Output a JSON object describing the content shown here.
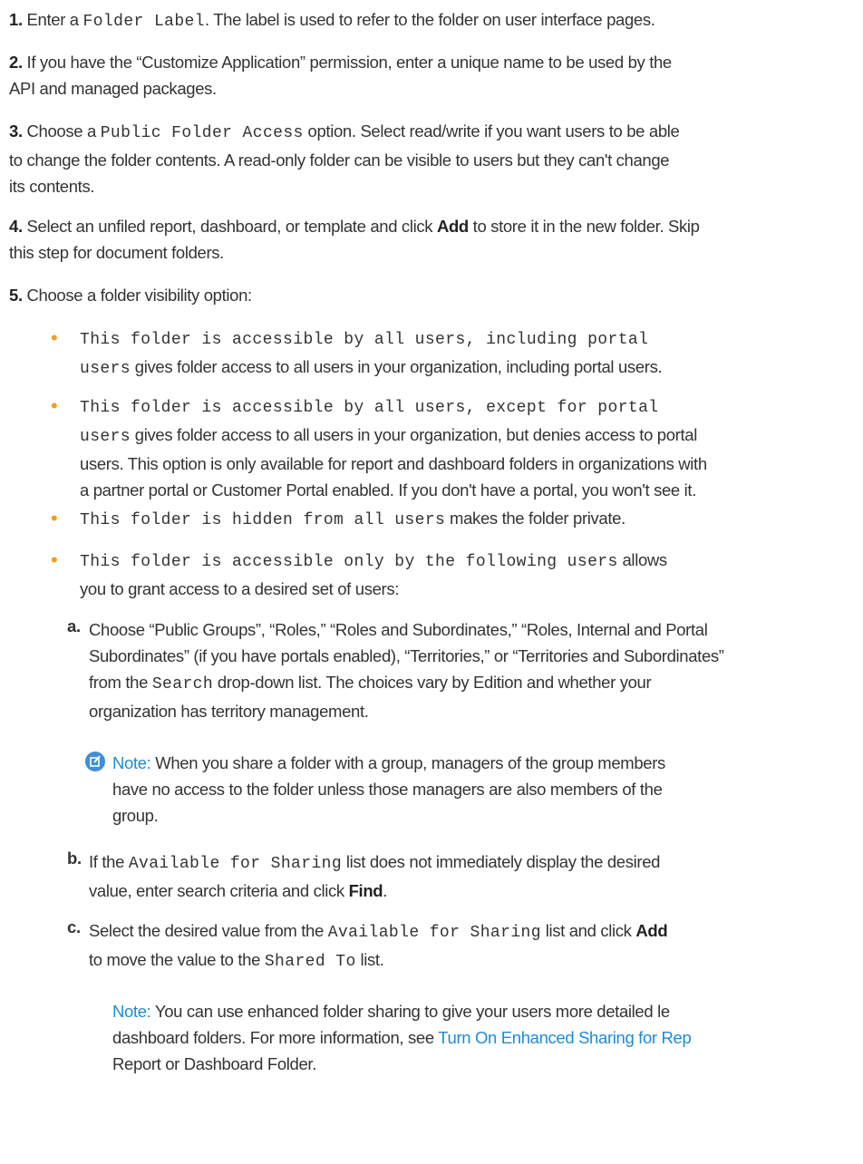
{
  "steps": [
    {
      "num": "1.",
      "a": "Enter a ",
      "code": "Folder Label",
      "b": ". The label is used to refer to the folder on user interface pages."
    },
    {
      "num": "2.",
      "l1": "If you have the “Customize Application” permission, enter a unique name to be used by the",
      "l2": "API and managed packages."
    },
    {
      "num": "3.",
      "a": "Choose a ",
      "code": "Public Folder Access",
      "b": " option. Select read/write if you want users to be able",
      "l2": "to change the folder contents. A read-only folder can be visible to users but they can't change",
      "l3": "its contents."
    },
    {
      "num": "4.",
      "a": "Select an unfiled report, dashboard, or template and click ",
      "bold": "Add",
      "b": " to store it in the new folder. Skip",
      "l2": "this step for document folders."
    },
    {
      "num": "5.",
      "a": "Choose a folder visibility option:"
    }
  ],
  "bullets": [
    {
      "code1": "This folder is accessible by all users, including portal",
      "code2": "users",
      "rest": " gives folder access to all users in your organization, including portal users."
    },
    {
      "code1": "This folder is accessible by all users, except for portal",
      "code2": "users",
      "rest": " gives folder access to all users in your organization, but denies access to portal",
      "l3": "users. This option is only available for report and dashboard folders in organizations with",
      "l4": "a partner portal or Customer Portal enabled. If you don't have a portal, you won't see it."
    },
    {
      "code1": "This folder is hidden from all users",
      "rest": " makes the folder private."
    },
    {
      "code1": "This folder is accessible only by the following users",
      "rest": " allows",
      "l2": "you to grant access to a desired set of users:"
    }
  ],
  "substeps": [
    {
      "lt": "a.",
      "l1": "Choose “Public Groups”, “Roles,” “Roles and Subordinates,” “Roles, Internal and Portal",
      "l2": "Subordinates” (if you have portals enabled), “Territories,” or “Territories and Subordinates”",
      "l3a": "from the ",
      "l3code": "Search",
      "l3b": " drop-down list. The choices vary by Edition and whether your",
      "l4": "organization has territory management."
    },
    {
      "lt": "b.",
      "a": "If the ",
      "code": "Available for Sharing",
      "b": " list does not immediately display the desired",
      "l2a": "value, enter search criteria and click ",
      "l2bold": "Find",
      "l2b": "."
    },
    {
      "lt": "c.",
      "a": "Select the desired value from the ",
      "code": "Available for Sharing",
      "b": " list and click ",
      "bold": "Add",
      "l2a": "to move the value to the ",
      "l2code": "Shared To",
      "l2b": " list."
    }
  ],
  "notes": [
    {
      "label": "Note:",
      "l1": " When you share a folder with a group, managers of the group members",
      "l2": "have no access to the folder unless those managers are also members of the",
      "l3": "group."
    },
    {
      "label": "Note:",
      "l1": " You can use enhanced folder sharing to give your users more detailed le",
      "l2a": "dashboard folders. For more information, see ",
      "link": "Turn On Enhanced Sharing for Rep",
      "l3": "Report or Dashboard Folder."
    }
  ]
}
